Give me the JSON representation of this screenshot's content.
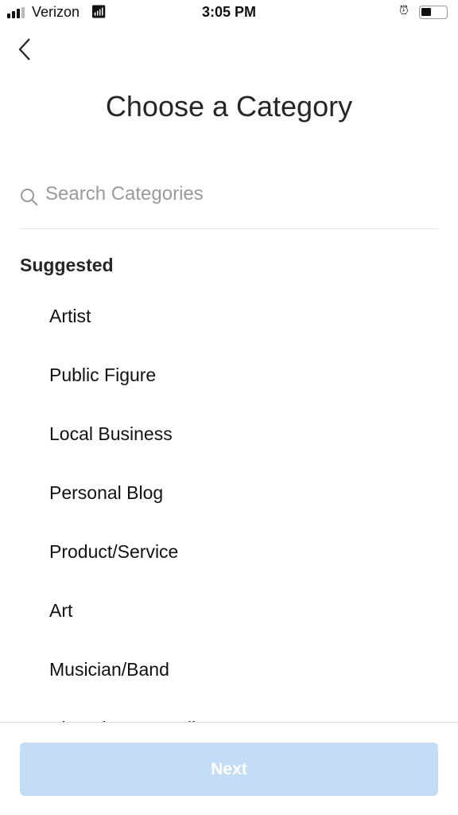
{
  "status_bar": {
    "carrier": "Verizon",
    "time": "3:05 PM",
    "wifi_icon": "wifi-icon",
    "alarm_icon": "alarm-icon",
    "battery_level": 0.35
  },
  "header": {
    "title": "Choose a Category",
    "back_icon": "chevron-left-icon"
  },
  "search": {
    "placeholder": "Search Categories",
    "value": ""
  },
  "section_label": "Suggested",
  "categories": [
    "Artist",
    "Public Figure",
    "Local Business",
    "Personal Blog",
    "Product/Service",
    "Art",
    "Musician/Band",
    "Shopping & Retail"
  ],
  "footer": {
    "next_label": "Next",
    "button_color": "#c3ddf7"
  }
}
